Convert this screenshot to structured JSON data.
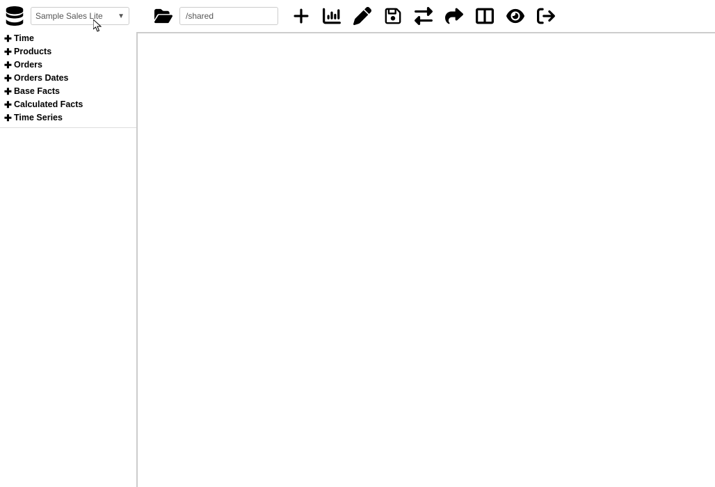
{
  "toolbar": {
    "datasource_selected": "Sample Sales Lite",
    "path_value": "/shared"
  },
  "tree": {
    "items": [
      {
        "label": "Time"
      },
      {
        "label": "Products"
      },
      {
        "label": "Orders"
      },
      {
        "label": "Orders Dates"
      },
      {
        "label": "Base Facts"
      },
      {
        "label": "Calculated Facts"
      },
      {
        "label": "Time Series"
      }
    ]
  }
}
